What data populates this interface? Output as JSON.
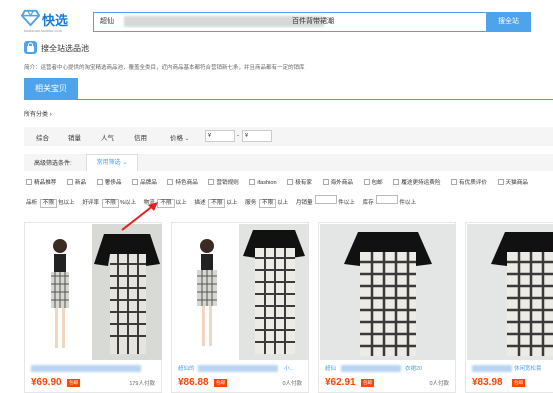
{
  "header": {
    "logo_text": "快选",
    "logo_url": "kuaixuan.taobao.com",
    "search_value_start": "超仙",
    "search_value_end": "百件背带裙潮",
    "search_button": "搜全站"
  },
  "pool": {
    "title": "搜全站选品池",
    "description": "简介：运营者中心提供的淘宝精选商品池，覆盖全类目，近内商品基本都符合营销新七条，并且商品都有一定的销库"
  },
  "tabs": [
    {
      "label": "相关宝贝"
    }
  ],
  "categories_label": "所有分类",
  "sort": {
    "items": [
      "综合",
      "销量",
      "人气",
      "信用",
      "价格"
    ],
    "price_from_placeholder": "¥",
    "price_to_placeholder": "¥",
    "dash": "-"
  },
  "filter": {
    "label": "高级筛选条件:",
    "tab": "常用筛选"
  },
  "checkboxes": [
    "精品推荐",
    "新品",
    "奢侈品",
    "品牌品",
    "特色商品",
    "营销规则",
    "ifashion",
    "极有家",
    "海外商品",
    "包邮",
    "履途更持运费险",
    "有优质评价",
    "天猫商品"
  ],
  "ranges": [
    {
      "label": "品析",
      "a": "不限",
      "b": "包以上"
    },
    {
      "label": "好评率",
      "a": "不限",
      "b": "%以上"
    },
    {
      "label": "物流",
      "a": "不限",
      "b": "以上"
    },
    {
      "label": "描述",
      "a": "不限",
      "b": "以上"
    },
    {
      "label": "服务",
      "a": "不限",
      "b": "以上"
    },
    {
      "label": "月销量",
      "a": "",
      "b": "件以上"
    },
    {
      "label": "库存",
      "a": "",
      "b": "件以上"
    }
  ],
  "products": [
    {
      "title": "",
      "price": "¥69.90",
      "badge": "包邮",
      "sales": "179人付款"
    },
    {
      "title": "超仙的",
      "title2": "小...",
      "price": "¥86.88",
      "badge": "包邮",
      "sales": "0人付款"
    },
    {
      "title": "超仙",
      "title2": "衣裙20",
      "price": "¥62.91",
      "badge": "包邮",
      "sales": "0人付款"
    },
    {
      "title": "",
      "title2": "休闲宽松套",
      "price": "¥83.98",
      "badge": "包邮",
      "sales": ""
    }
  ],
  "colors": {
    "accent": "#4fa3ea",
    "price": "#ff4400",
    "arrow": "#e02020"
  }
}
